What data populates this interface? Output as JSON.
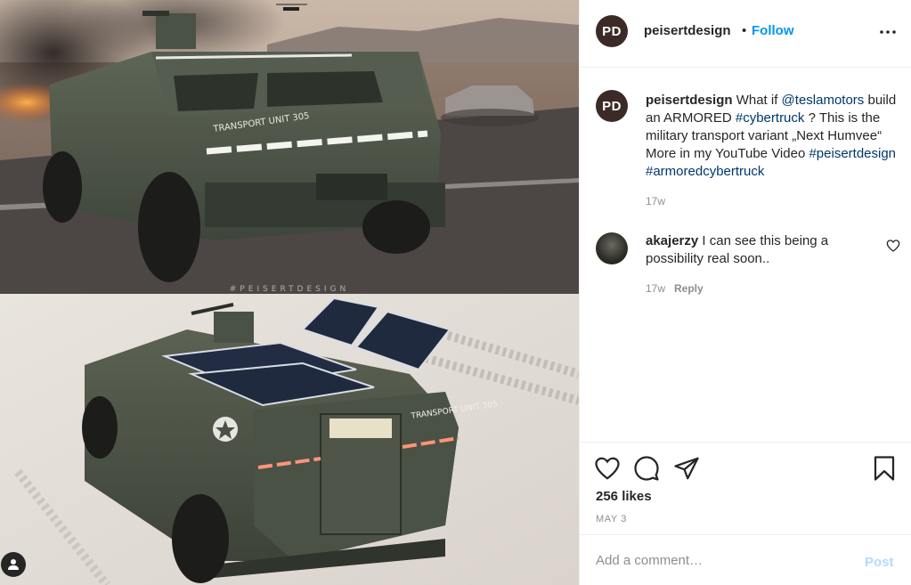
{
  "post": {
    "author": {
      "username": "peisertdesign",
      "avatar_initials": "PD"
    },
    "header": {
      "separator": "•",
      "follow_label": "Follow"
    },
    "image": {
      "watermark": "#PEISERTDESIGN",
      "top_vehicle_text": "TRANSPORT UNIT 305",
      "bottom_vehicle_text": "TRANSPORT UNIT 305"
    },
    "caption": {
      "username": "peisertdesign",
      "part1": " What if ",
      "mention": "@teslamotors",
      "part2": " build an ARMORED ",
      "hashtag1": "#cybertruck",
      "part3": " ? This is the military transport variant „Next Humvee“ More in my YouTube Video ",
      "hashtag2": "#peisertdesign",
      "part4": " ",
      "hashtag3": "#armoredcybertruck",
      "time": "17w"
    },
    "comments": [
      {
        "username": "akajerzy",
        "text": " I can see this being a possibility real soon..",
        "time": "17w",
        "reply_label": "Reply"
      }
    ],
    "likes": "256 likes",
    "date": "MAY 3",
    "add_comment": {
      "placeholder": "Add a comment…",
      "post_label": "Post"
    }
  },
  "icons": {
    "more": "more-options-icon",
    "like": "heart-icon",
    "comment": "comment-bubble-icon",
    "share": "paper-plane-icon",
    "save": "bookmark-icon",
    "tag": "user-tag-icon"
  },
  "colors": {
    "accent": "#0095f6",
    "link": "#00376b",
    "muted": "#8e8e8e",
    "post_disabled": "#b3dbff",
    "vehicle": "#4e5647"
  }
}
